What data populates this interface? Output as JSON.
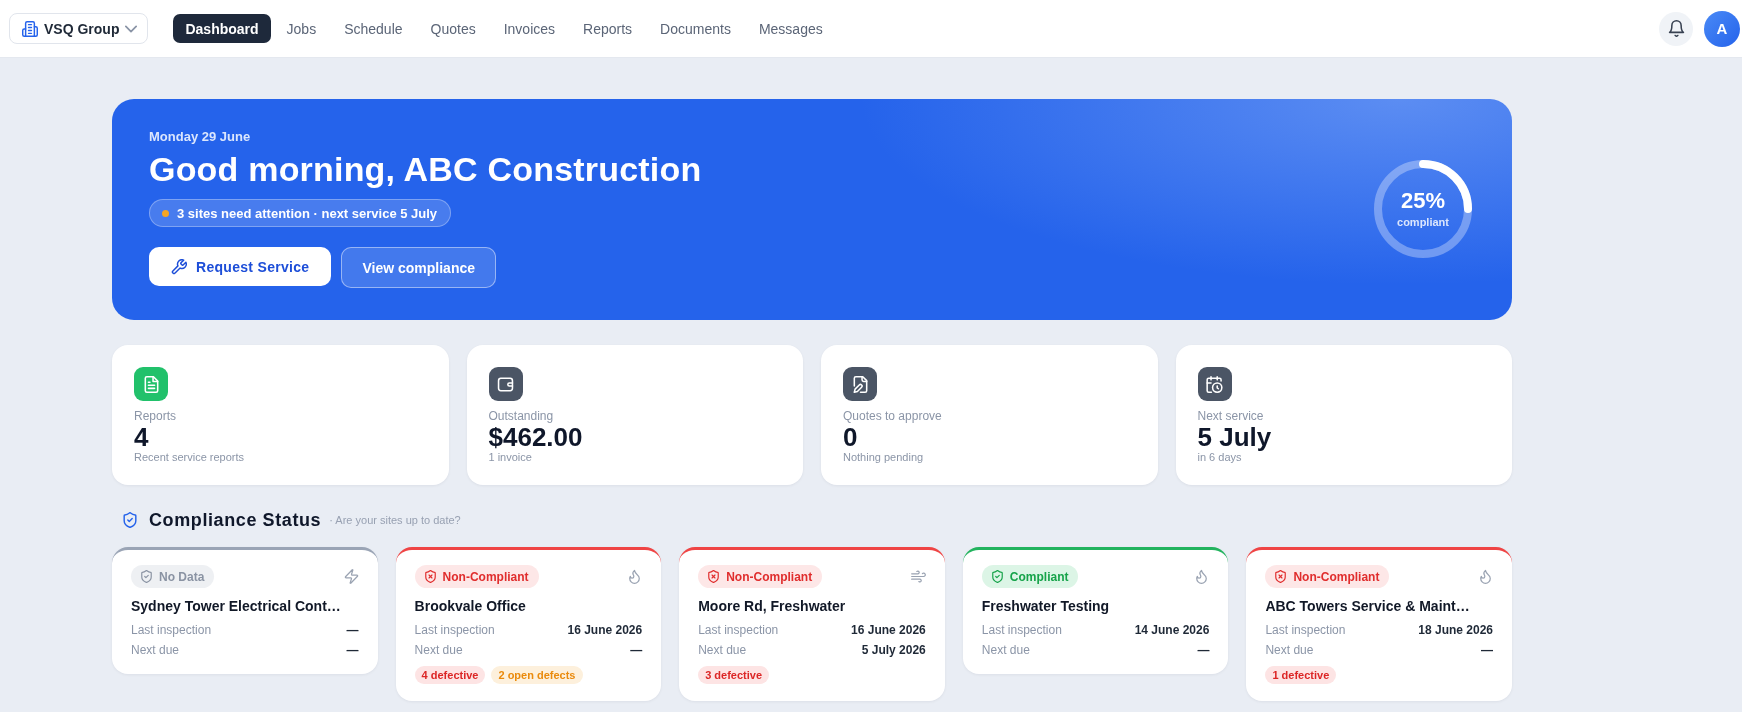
{
  "org_switcher": {
    "label": "VSQ Group"
  },
  "nav": [
    {
      "label": "Dashboard",
      "selected": true
    },
    {
      "label": "Jobs",
      "selected": false
    },
    {
      "label": "Schedule",
      "selected": false
    },
    {
      "label": "Quotes",
      "selected": false
    },
    {
      "label": "Invoices",
      "selected": false
    },
    {
      "label": "Reports",
      "selected": false
    },
    {
      "label": "Documents",
      "selected": false
    },
    {
      "label": "Messages",
      "selected": false
    }
  ],
  "user": {
    "avatar": "A"
  },
  "hero": {
    "date": "Monday 29 June",
    "greeting": "Good morning, ABC Construction",
    "notice": "3 sites need attention · next service 5 July",
    "buttons": [
      {
        "label": "Request Service",
        "kind": "primary"
      },
      {
        "label": "View compliance",
        "kind": "secondary"
      }
    ],
    "compliance": {
      "value": "25%",
      "label": "compliant",
      "level": 0.25
    }
  },
  "stats": [
    {
      "label": "Reports",
      "value": "4",
      "sub": "Recent service reports",
      "color": "#21c16b"
    },
    {
      "label": "Outstanding",
      "value": "$462.00",
      "sub": "1 invoice",
      "color": "#4b5565"
    },
    {
      "label": "Quotes to approve",
      "value": "0",
      "sub": "Nothing pending",
      "color": "#4b5565"
    },
    {
      "label": "Next service",
      "value": "5 July",
      "sub": "in 6 days",
      "color": "#4b5565"
    }
  ],
  "compliance_section": {
    "title": "Compliance Status",
    "subtitle": "· Are your sites up to date?",
    "sites": [
      {
        "status": {
          "kind": "no_data",
          "label": "No Data"
        },
        "name": "Sydney Tower Electrical Cont…",
        "details": [
          {
            "label": "Last inspection",
            "value": "—"
          },
          {
            "label": "Next due",
            "value": "—"
          }
        ]
      },
      {
        "status": {
          "kind": "non_compliant",
          "label": "Non-Compliant"
        },
        "name": "Brookvale Office",
        "details": [
          {
            "label": "Last inspection",
            "value": "16 June 2026"
          },
          {
            "label": "Next due",
            "value": "—"
          }
        ],
        "tags": [
          {
            "label": "4 defective",
            "kind": "defective"
          },
          {
            "label": "2 open defects",
            "kind": "open"
          }
        ]
      },
      {
        "status": {
          "kind": "non_compliant",
          "label": "Non-Compliant"
        },
        "name": "Moore Rd, Freshwater",
        "details": [
          {
            "label": "Last inspection",
            "value": "16 June 2026"
          },
          {
            "label": "Next due",
            "value": "5 July 2026"
          }
        ],
        "tags": [
          {
            "label": "3 defective",
            "kind": "defective"
          }
        ]
      },
      {
        "status": {
          "kind": "compliant",
          "label": "Compliant"
        },
        "name": "Freshwater Testing",
        "details": [
          {
            "label": "Last inspection",
            "value": "14 June 2026"
          },
          {
            "label": "Next due",
            "value": "—"
          }
        ]
      },
      {
        "status": {
          "kind": "non_compliant",
          "label": "Non-Compliant"
        },
        "name": "ABC Towers Service & Maint…",
        "details": [
          {
            "label": "Last inspection",
            "value": "18 June 2026"
          },
          {
            "label": "Next due",
            "value": "—"
          }
        ],
        "tags": [
          {
            "label": "1 defective",
            "kind": "defective"
          }
        ]
      }
    ]
  }
}
